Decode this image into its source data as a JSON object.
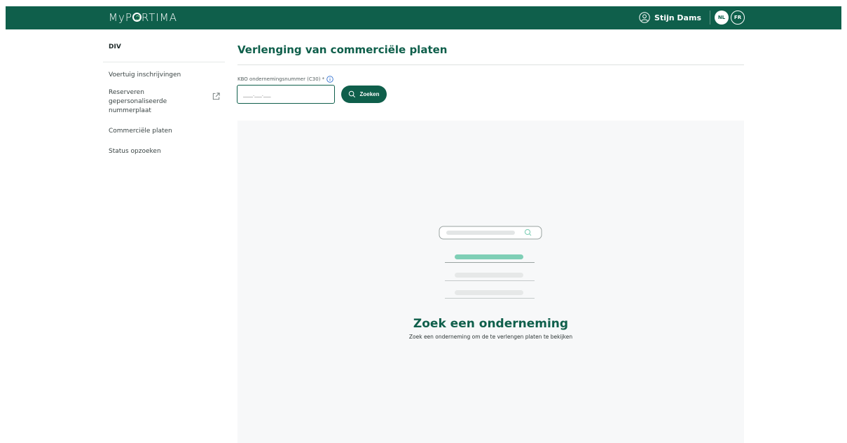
{
  "header": {
    "logo_text_left": "MyP",
    "logo_text_right": "RTIMA",
    "user_name": "Stijn Dams",
    "languages": [
      {
        "code": "NL",
        "active": true
      },
      {
        "code": "FR",
        "active": false
      }
    ]
  },
  "sidebar": {
    "heading": "DIV",
    "items": [
      {
        "label": "Voertuig inschrijvingen"
      },
      {
        "label": "Reserveren gepersonaliseerde nummerplaat",
        "icon": "external-link-icon"
      },
      {
        "label": "Commerciële platen"
      },
      {
        "label": "Status opzoeken"
      }
    ]
  },
  "main": {
    "title": "Verlenging van commerciële platen",
    "field_label": "KBO ondernemingsnummer (C30) *",
    "input_placeholder": "____.___.___",
    "search_button": "Zoeken"
  },
  "empty_state": {
    "title": "Zoek een onderneming",
    "subtitle": "Zoek een onderneming om de te verlengen platen te bekijken"
  },
  "colors": {
    "brand": "#0f5f4b",
    "accent_light": "#7fcfb6",
    "panel_bg": "#f7f8f9"
  }
}
